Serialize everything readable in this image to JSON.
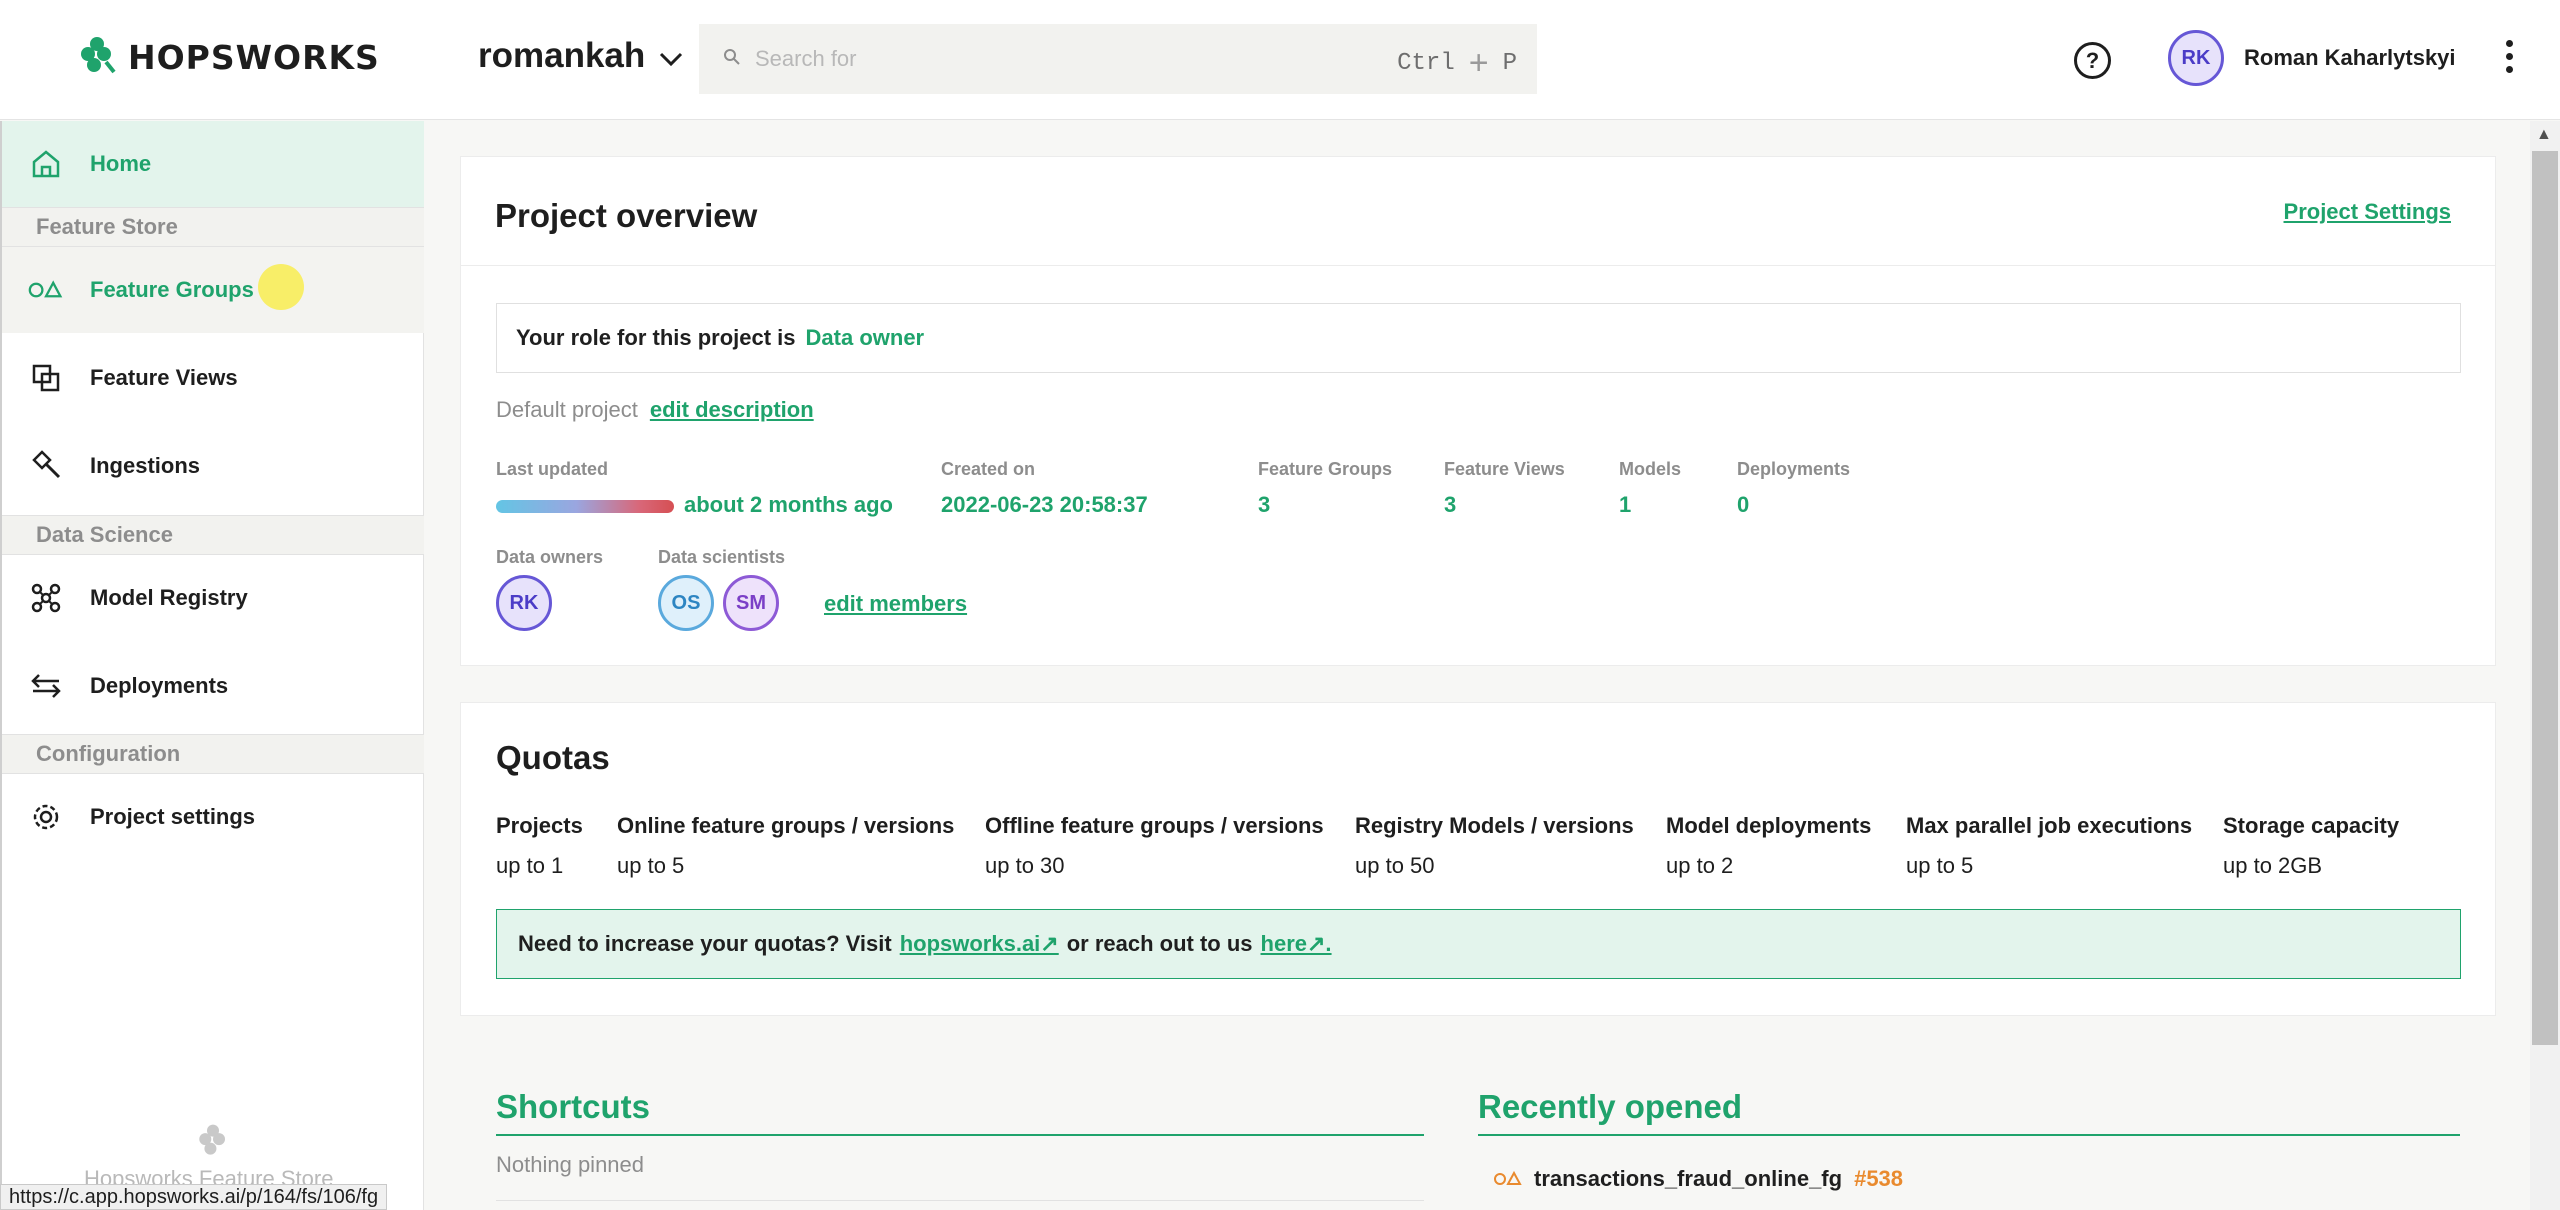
{
  "header": {
    "logo_text": "HOPSWORKS",
    "project_name": "romankah",
    "search_placeholder": "Search for",
    "shortcut_ctrl": "Ctrl",
    "shortcut_plus": "+",
    "shortcut_key": "P",
    "help_label": "?",
    "user_initials": "RK",
    "user_name": "Roman Kaharlytskyi"
  },
  "sidebar": {
    "home": "Home",
    "section_feature_store": "Feature Store",
    "feature_groups": "Feature Groups",
    "feature_views": "Feature Views",
    "ingestions": "Ingestions",
    "section_data_science": "Data Science",
    "model_registry": "Model Registry",
    "deployments": "Deployments",
    "section_configuration": "Configuration",
    "project_settings": "Project settings",
    "footer_text": "Hopsworks Feature Store",
    "status_url": "https://c.app.hopsworks.ai/p/164/fs/106/fg"
  },
  "overview": {
    "title": "Project overview",
    "settings_link": "Project Settings",
    "role_prefix": "Your role for this project is",
    "role": "Data owner",
    "description": "Default project",
    "edit_description": "edit description",
    "last_updated_label": "Last updated",
    "last_updated_value": "about 2 months ago",
    "created_label": "Created on",
    "created_value": "2022-06-23 20:58:37",
    "feature_groups_label": "Feature Groups",
    "feature_groups_value": "3",
    "feature_views_label": "Feature Views",
    "feature_views_value": "3",
    "models_label": "Models",
    "models_value": "1",
    "deployments_label": "Deployments",
    "deployments_value": "0",
    "data_owners_label": "Data owners",
    "data_scientists_label": "Data scientists",
    "owner_initials": [
      "RK"
    ],
    "scientist_initials": [
      "OS",
      "SM"
    ],
    "edit_members": "edit members"
  },
  "quotas": {
    "title": "Quotas",
    "items": [
      {
        "label": "Projects",
        "value": "up to 1"
      },
      {
        "label": "Online feature groups / versions",
        "value": "up to 5"
      },
      {
        "label": "Offline feature groups / versions",
        "value": "up to 30"
      },
      {
        "label": "Registry Models / versions",
        "value": "up to 50"
      },
      {
        "label": "Model deployments",
        "value": "up to 2"
      },
      {
        "label": "Max parallel job executions",
        "value": "up to 5"
      },
      {
        "label": "Storage capacity",
        "value": "up to 2GB"
      }
    ],
    "notice_prefix": "Need to increase your quotas? Visit",
    "notice_link1": "hopsworks.ai↗",
    "notice_middle": "or reach out to us",
    "notice_link2": "here↗."
  },
  "shortcuts": {
    "title": "Shortcuts",
    "empty": "Nothing pinned"
  },
  "recent": {
    "title": "Recently opened",
    "items": [
      {
        "name": "transactions_fraud_online_fg",
        "id": "#538"
      }
    ]
  },
  "colors": {
    "accent": "#1fa36c",
    "accent_bg": "#e3f4ec",
    "recent_id": "#e98a2e"
  },
  "icons": {
    "logo": "hop-cone-icon",
    "search": "search-icon",
    "chevron": "chevron-down-icon",
    "help": "help-circle-icon",
    "menu": "kebab-menu-icon",
    "home": "home-icon",
    "feature_groups": "circle-triangle-icon",
    "feature_views": "overlap-squares-icon",
    "ingestions": "hammer-icon",
    "model_registry": "graph-nodes-icon",
    "deployments": "swap-arrows-icon",
    "settings": "gear-icon"
  }
}
